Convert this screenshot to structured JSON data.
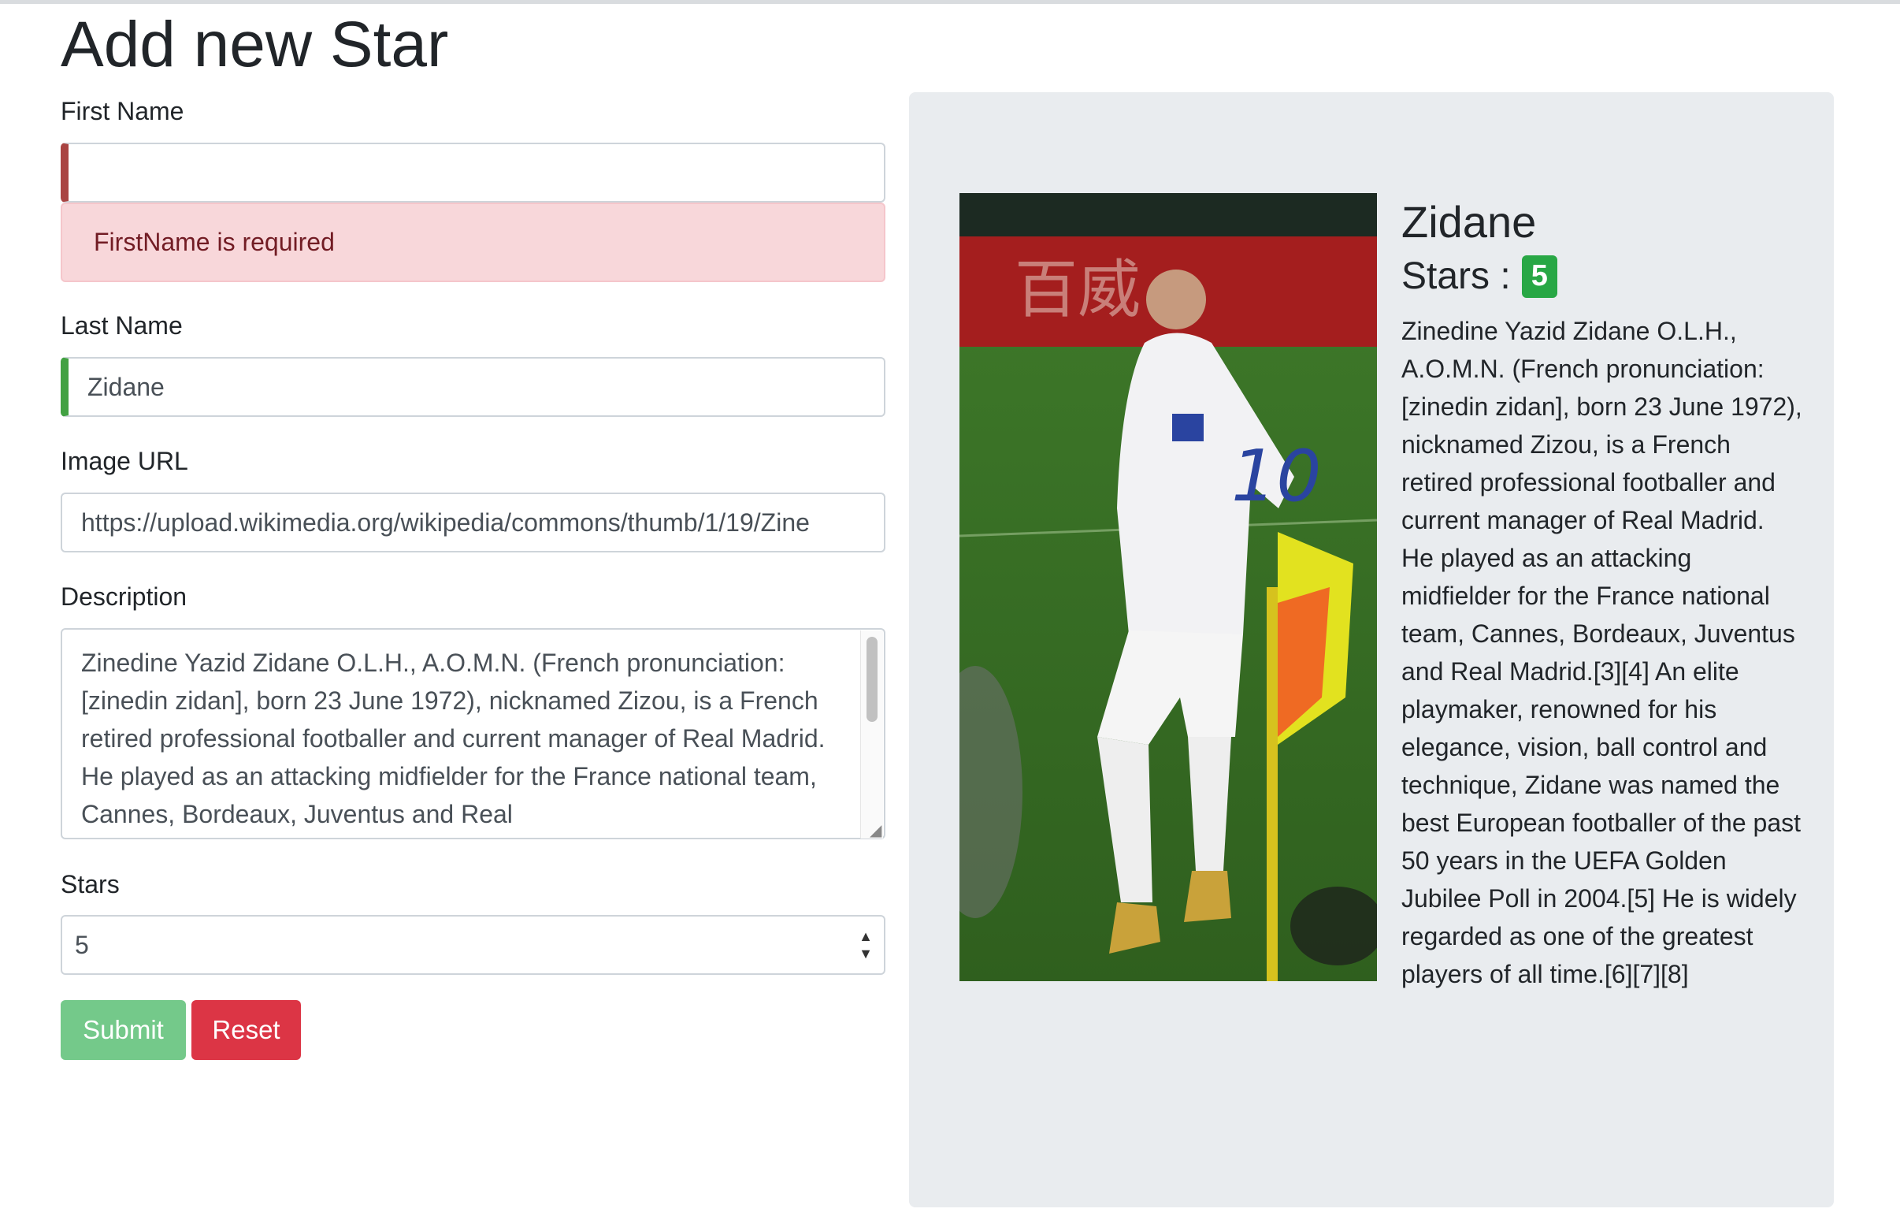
{
  "page": {
    "title": "Add new Star"
  },
  "form": {
    "first_name": {
      "label": "First Name",
      "value": "",
      "error": "FirstName is required"
    },
    "last_name": {
      "label": "Last Name",
      "value": "Zidane"
    },
    "image_url": {
      "label": "Image URL",
      "value": "https://upload.wikimedia.org/wikipedia/commons/thumb/1/19/Zine"
    },
    "description": {
      "label": "Description",
      "value": "Zinedine Yazid Zidane O.L.H., A.O.M.N. (French pronunciation: [zinedin zidan], born 23 June 1972), nicknamed Zizou, is a French retired professional footballer and current manager of Real Madrid. He played as an attacking midfielder for the France national team, Cannes, Bordeaux, Juventus and Real"
    },
    "stars": {
      "label": "Stars",
      "value": "5"
    },
    "submit_label": "Submit",
    "reset_label": "Reset"
  },
  "preview": {
    "name": "Zidane",
    "stars_label": "Stars :",
    "stars_value": "5",
    "description": "Zinedine Yazid Zidane O.L.H., A.O.M.N. (French pronunciation: [zinedin zidan], born 23 June 1972), nicknamed Zizou, is a French retired professional footballer and current manager of Real Madrid. He played as an attacking midfielder for the France national team, Cannes, Bordeaux, Juventus and Real Madrid.[3][4] An elite playmaker, renowned for his elegance, vision, ball control and technique, Zidane was named the best European footballer of the past 50 years in the UEFA Golden Jubilee Poll in 2004.[5] He is widely regarded as one of the greatest players of all time.[6][7][8]"
  },
  "colors": {
    "invalid": "#a94442",
    "valid": "#42a142",
    "alert_bg": "#f8d7da",
    "submit": "#74c98a",
    "reset": "#dc3545",
    "badge": "#28a745",
    "panel": "#e9ecef"
  }
}
